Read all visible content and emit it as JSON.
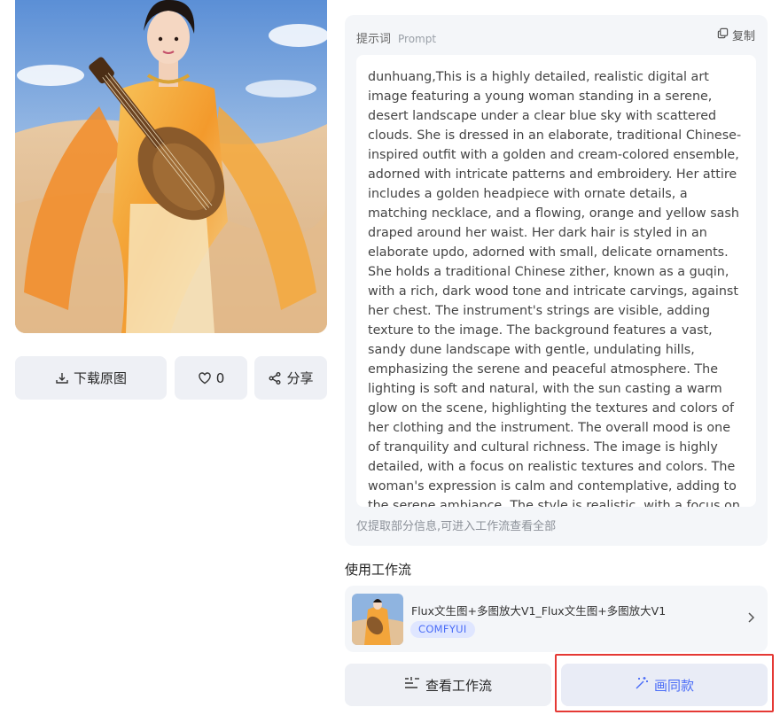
{
  "artwork": {
    "alt": "dunhuang woman with pipa in desert"
  },
  "actions": {
    "download_label": "下载原图",
    "like_count": "0",
    "share_label": "分享"
  },
  "prompt": {
    "title": "提示词",
    "title_en": "Prompt",
    "copy_label": "复制",
    "text": "dunhuang,This is a highly detailed, realistic digital art image featuring a young woman standing in a serene, desert landscape under a clear blue sky with scattered clouds. She is dressed in an elaborate, traditional Chinese-inspired outfit with a golden and cream-colored ensemble, adorned with intricate patterns and embroidery. Her attire includes a golden headpiece with ornate details, a matching necklace, and a flowing, orange and yellow sash draped around her waist. Her dark hair is styled in an elaborate updo, adorned with small, delicate ornaments. She holds a traditional Chinese zither, known as a guqin, with a rich, dark wood tone and intricate carvings, against her chest. The instrument's strings are visible, adding texture to the image. The background features a vast, sandy dune landscape with gentle, undulating hills, emphasizing the serene and peaceful atmosphere. The lighting is soft and natural, with the sun casting a warm glow on the scene, highlighting the textures and colors of her clothing and the instrument. The overall mood is one of tranquility and cultural richness. The image is highly detailed, with a focus on realistic textures and colors. The woman's expression is calm and contemplative, adding to the serene ambiance. The style is realistic, with a focus on traditional",
    "note": "仅提取部分信息,可进入工作流查看全部"
  },
  "workflow": {
    "section_title": "使用工作流",
    "name": "Flux文生图+多图放大V1_Flux文生图+多图放大V1",
    "tag": "COMFYUI"
  },
  "bottom": {
    "view_workflow_label": "查看工作流",
    "draw_same_label": "画同款"
  },
  "colors": {
    "accent": "#4a6cf7",
    "highlight": "#e53935"
  },
  "icons": [
    "download-icon",
    "heart-icon",
    "share-icon",
    "copy-icon",
    "chevron-right-icon",
    "list-icon",
    "sparkle-icon"
  ]
}
